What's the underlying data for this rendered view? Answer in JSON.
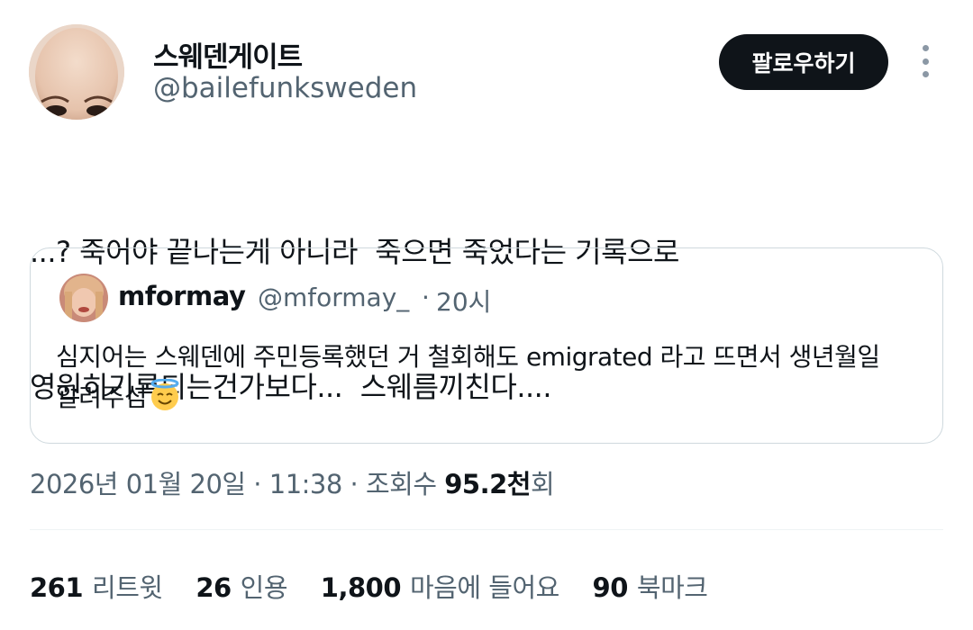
{
  "author": {
    "display_name": "스웨덴게이트",
    "handle": "@bailefunksweden"
  },
  "header": {
    "follow_label": "팔로우하기",
    "more_icon": "more-vertical-icon"
  },
  "post": {
    "lines": [
      "...? 죽어야 끝나는게 아니라  죽으면 죽었다는 기록으로",
      "영원히기록되는건가보다...  스웨름끼친다...."
    ]
  },
  "quote": {
    "name": "mformay",
    "handle": "@mformay_",
    "separator": "·",
    "time": "20시",
    "lines": [
      "심지어는 스웨덴에 주민등록했던 거 철회해도 emigrated 라고 뜨면서 생년월일",
      "알려주심"
    ],
    "emoji": "smiling-face-with-halo"
  },
  "meta": {
    "date": "2026년 01월 20일",
    "sep1": " · ",
    "time": "11:38",
    "sep2": " · ",
    "views_label": "조회수 ",
    "views_number": "95.2천",
    "views_suffix": "회"
  },
  "stats": {
    "retweets_count": "261",
    "retweets_label": "리트윗",
    "quotes_count": "26",
    "quotes_label": "인용",
    "likes_count": "1,800",
    "likes_label": "마음에 들어요",
    "bookmarks_count": "90",
    "bookmarks_label": "북마크"
  }
}
